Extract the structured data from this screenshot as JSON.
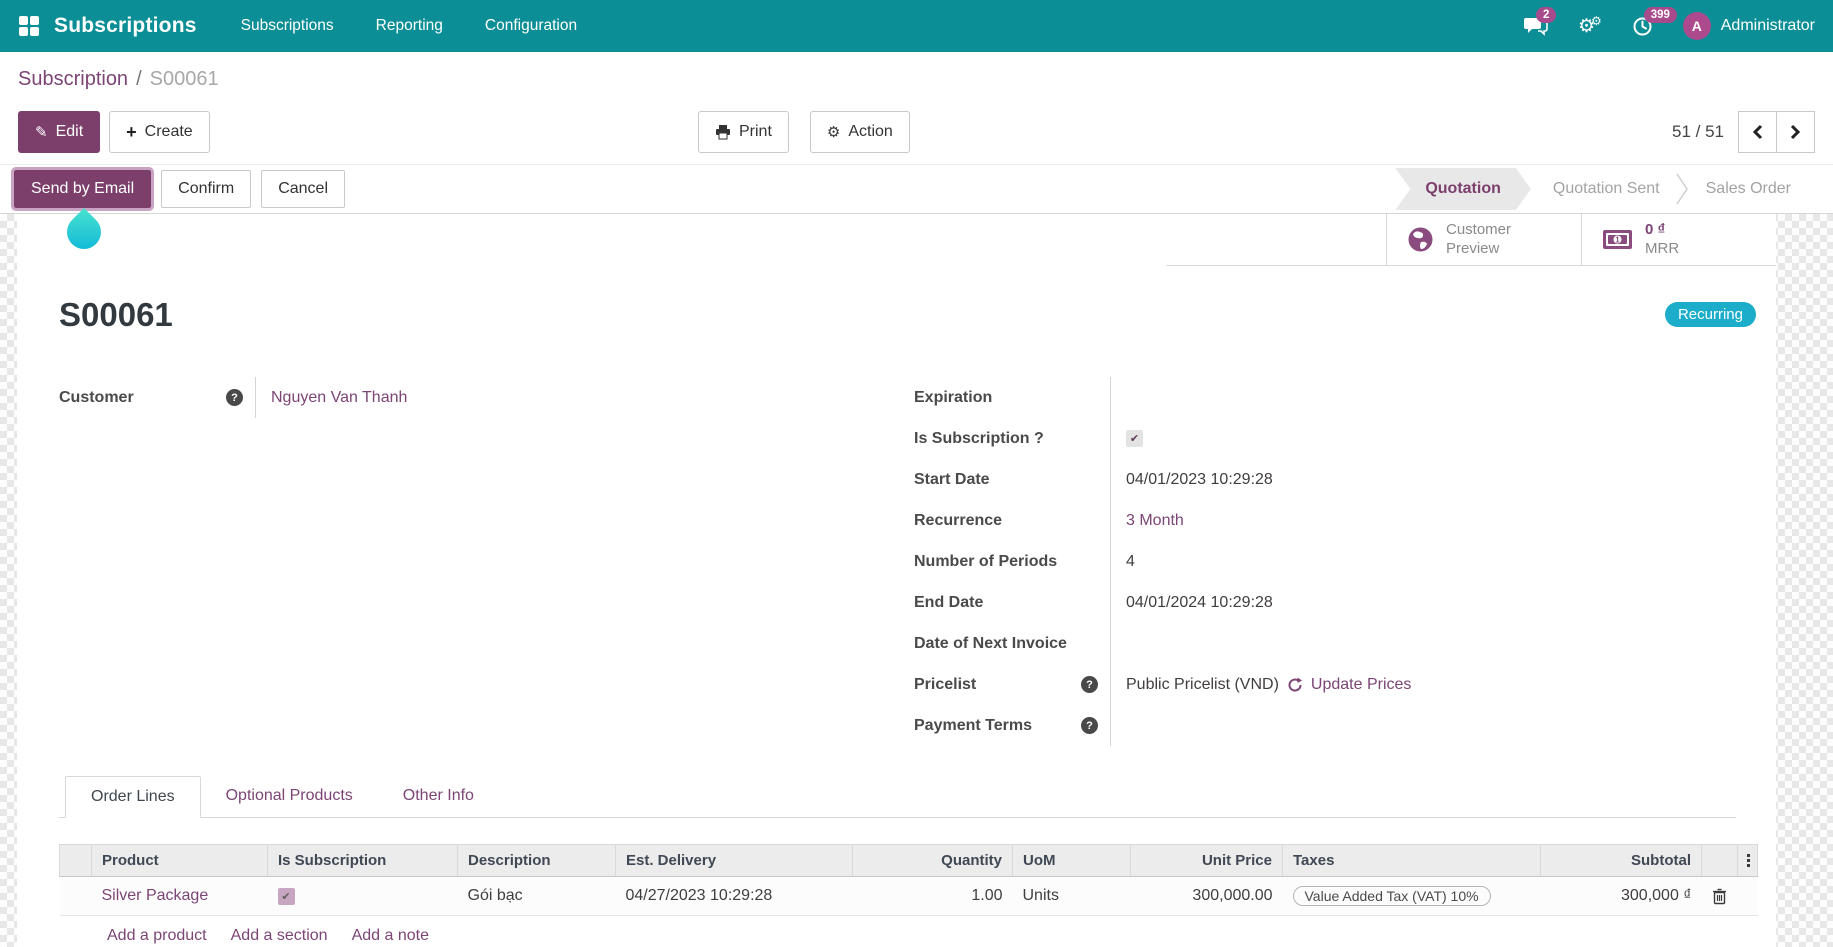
{
  "navbar": {
    "app_name": "Subscriptions",
    "menu_items": [
      "Subscriptions",
      "Reporting",
      "Configuration"
    ],
    "messages_badge": "2",
    "activities_badge": "399",
    "user_initial": "A",
    "user_name": "Administrator"
  },
  "breadcrumb": {
    "parent": "Subscription",
    "separator": "/",
    "current": "S00061"
  },
  "control_panel": {
    "edit_label": "Edit",
    "create_label": "Create",
    "print_label": "Print",
    "action_label": "Action",
    "pager_value": "51 / 51"
  },
  "statusbar": {
    "send_by_email_label": "Send by Email",
    "confirm_label": "Confirm",
    "cancel_label": "Cancel",
    "states": [
      {
        "label": "Quotation"
      },
      {
        "label": "Quotation Sent"
      },
      {
        "label": "Sales Order"
      }
    ],
    "active_state": "Quotation"
  },
  "smart_buttons": {
    "customer_preview_line1": "Customer",
    "customer_preview_line2": "Preview",
    "mrr_value": "0 ₫",
    "mrr_label": "MRR"
  },
  "sheet": {
    "title": "S00061",
    "recurring_badge": "Recurring",
    "customer": {
      "label": "Customer",
      "value": "Nguyen Van Thanh"
    },
    "fields": [
      {
        "label": "Expiration",
        "value": ""
      },
      {
        "label": "Is Subscription ?",
        "value": "checked"
      },
      {
        "label": "Start Date",
        "value": "04/01/2023 10:29:28"
      },
      {
        "label": "Recurrence",
        "value": "3 Month"
      },
      {
        "label": "Number of Periods",
        "value": "4"
      },
      {
        "label": "End Date",
        "value": "04/01/2024 10:29:28"
      },
      {
        "label": "Date of Next Invoice",
        "value": ""
      },
      {
        "label": "Pricelist",
        "value": "Public Pricelist (VND)",
        "action": "Update Prices"
      },
      {
        "label": "Payment Terms",
        "value": ""
      }
    ]
  },
  "notebook": {
    "tabs": [
      "Order Lines",
      "Optional Products",
      "Other Info"
    ],
    "active_tab": "Order Lines"
  },
  "order_lines": {
    "headers": {
      "product": "Product",
      "is_subscription": "Is Subscription",
      "description": "Description",
      "est_delivery": "Est. Delivery",
      "quantity": "Quantity",
      "uom": "UoM",
      "unit_price": "Unit Price",
      "taxes": "Taxes",
      "subtotal": "Subtotal"
    },
    "rows": [
      {
        "product": "Silver Package",
        "is_subscription": "checked",
        "description": "Gói bạc",
        "est_delivery": "04/27/2023 10:29:28",
        "quantity": "1.00",
        "uom": "Units",
        "unit_price": "300,000.00",
        "taxes": "Value Added Tax (VAT) 10%",
        "subtotal": "300,000 ₫"
      }
    ],
    "footer_links": [
      "Add a product",
      "Add a section",
      "Add a note"
    ]
  },
  "colors": {
    "navbar_teal": "#0b8e96",
    "primary_purple": "#7c3f6c",
    "link_purple": "#7c4576",
    "magenta_badge": "#a84b8d",
    "recurring_badge": "#1badc9",
    "droplet": "#1fc9d2"
  }
}
